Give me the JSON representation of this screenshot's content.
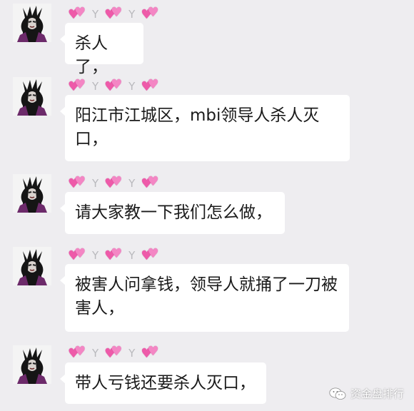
{
  "messages": [
    {
      "sender_marks": [
        "💕",
        "Y",
        "💕",
        "Y",
        "💕"
      ],
      "text": "杀人了，"
    },
    {
      "sender_marks": [
        "💕",
        "Y",
        "💕",
        "Y",
        "💕"
      ],
      "text": "阳江市江城区，mbi领导人杀人灭口，"
    },
    {
      "sender_marks": [
        "💕",
        "Y",
        "💕",
        "Y",
        "💕"
      ],
      "text": "请大家教一下我们怎么做，"
    },
    {
      "sender_marks": [
        "💕",
        "Y",
        "💕",
        "Y",
        "💕"
      ],
      "text": "被害人问拿钱，领导人就捅了一刀被害人，"
    },
    {
      "sender_marks": [
        "💕",
        "Y",
        "💕",
        "Y",
        "💕"
      ],
      "text": "带人亏钱还要杀人灭口，"
    }
  ],
  "watermark": {
    "icon": "wechat-icon",
    "text": "资金盘排行"
  },
  "colors": {
    "background": "#eeedf0",
    "bubble": "#ffffff",
    "text": "#1a1a1a",
    "heart": "#f06ab5"
  }
}
